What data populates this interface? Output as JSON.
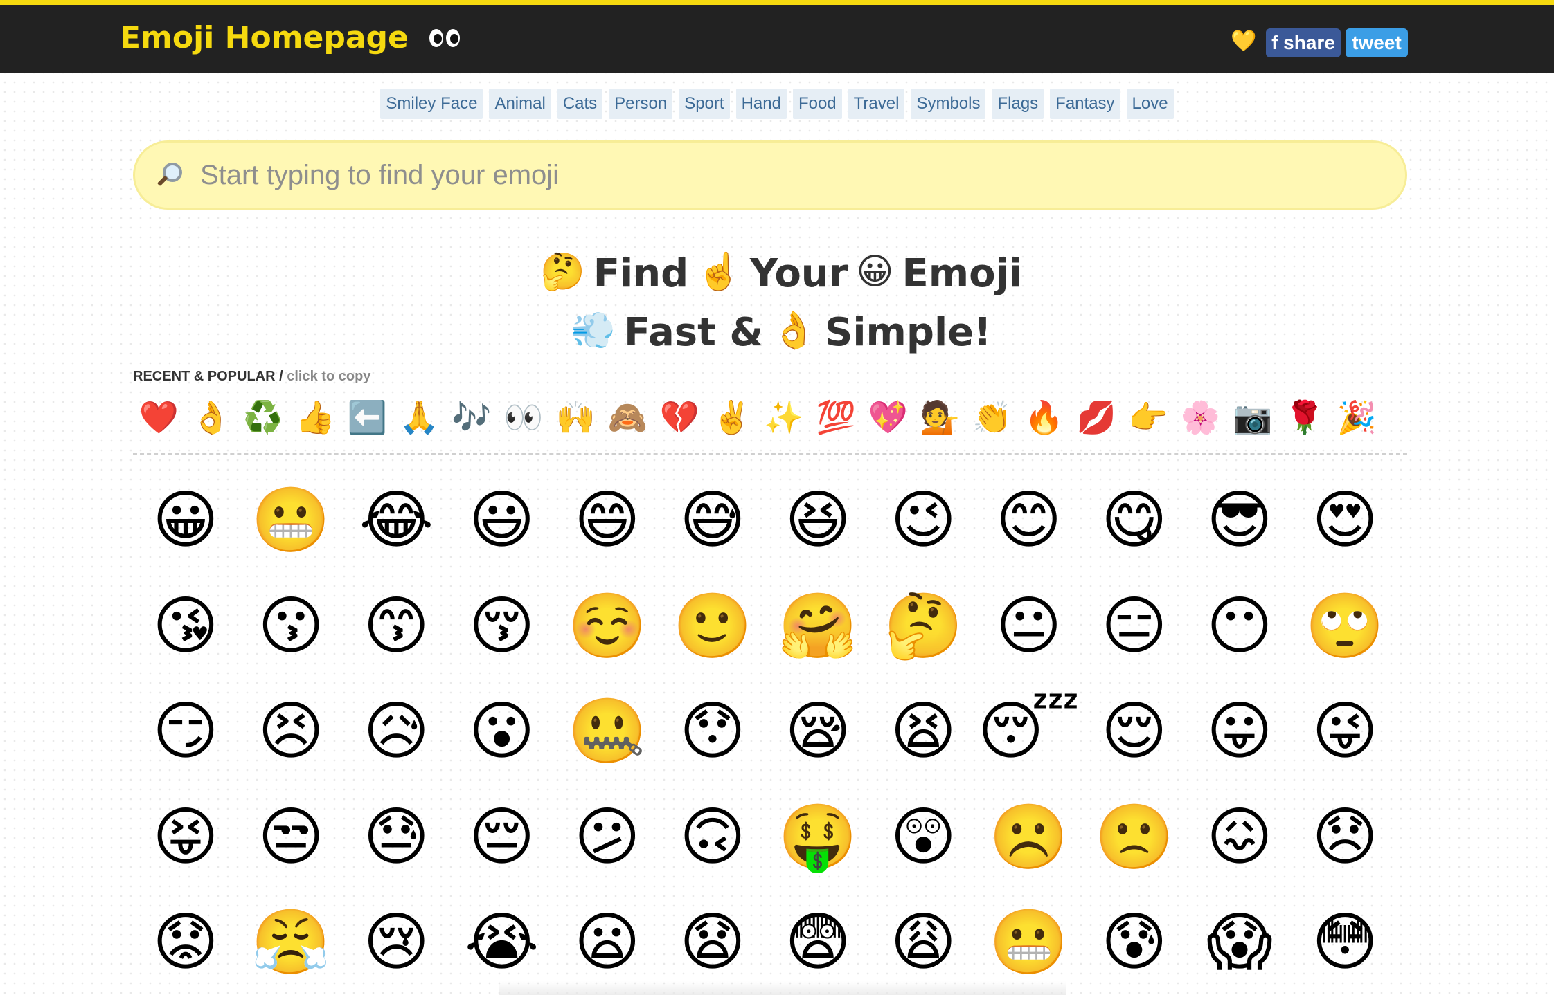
{
  "header": {
    "title": "Emoji Homepage",
    "heart": "💛",
    "share_label": "f share",
    "tweet_label": "tweet",
    "brand_color": "#f5d90f",
    "bar_color": "#222222"
  },
  "categories": [
    "Smiley Face",
    "Animal",
    "Cats",
    "Person",
    "Sport",
    "Hand",
    "Food",
    "Travel",
    "Symbols",
    "Flags",
    "Fantasy",
    "Love"
  ],
  "search": {
    "placeholder": "Start typing to find your emoji",
    "icon": "magnifying-glass-icon"
  },
  "hero": {
    "line1": [
      "🤔",
      "Find",
      "☝️",
      "Your",
      "😀",
      "Emoji"
    ],
    "line2": [
      "💨",
      "Fast &",
      "👌",
      "Simple!"
    ]
  },
  "recent": {
    "label": "RECENT & POPULAR /",
    "sub": "click to copy",
    "items": [
      "❤️",
      "👌",
      "♻️",
      "👍",
      "⬅️",
      "🙏",
      "🎶",
      "👀",
      "🙌",
      "🙈",
      "💔",
      "✌️",
      "✨",
      "💯",
      "💖",
      "💁",
      "👏",
      "🔥",
      "💋",
      "👉",
      "🌸",
      "📷",
      "🌹",
      "🎉"
    ]
  },
  "emoji_grid": [
    [
      "😀",
      "😬",
      "😂",
      "😃",
      "😄",
      "😅",
      "😆",
      "😉",
      "😊",
      "😋",
      "😎",
      "😍"
    ],
    [
      "😘",
      "😗",
      "😙",
      "😚",
      "☺️",
      "🙂",
      "🤗",
      "🤔",
      "😐",
      "😑",
      "😶",
      "🙄"
    ],
    [
      "😏",
      "😣",
      "😥",
      "😮",
      "🤐",
      "😯",
      "😪",
      "😫",
      "😴",
      "😌",
      "😛",
      "😜"
    ],
    [
      "😝",
      "😒",
      "😓",
      "😔",
      "😕",
      "🙃",
      "🤑",
      "😲",
      "☹️",
      "🙁",
      "😖",
      "😞"
    ],
    [
      "😟",
      "😤",
      "😢",
      "😭",
      "😦",
      "😧",
      "😨",
      "😩",
      "😬",
      "😰",
      "😱",
      "😳"
    ]
  ]
}
